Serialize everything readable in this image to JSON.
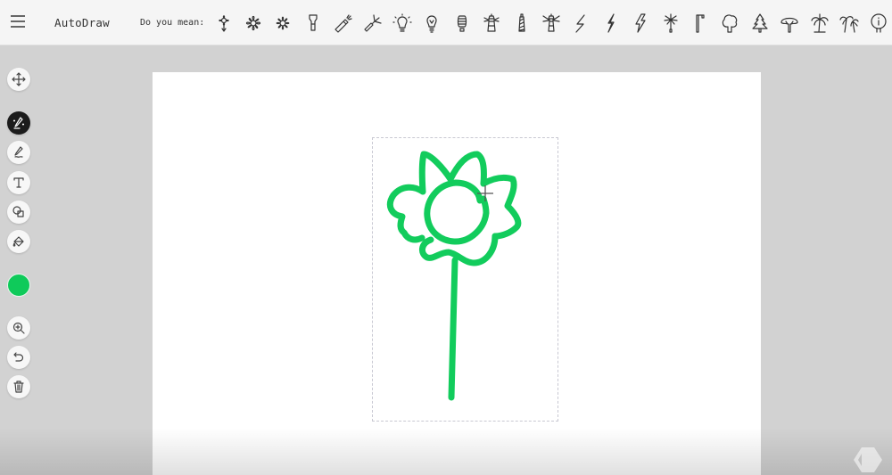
{
  "header": {
    "menu_icon": "hamburger-menu-icon",
    "title": "AutoDraw",
    "suggestions_label": "Do you mean:",
    "suggestions": [
      {
        "name": "flower-simple-icon"
      },
      {
        "name": "flower-detailed-icon"
      },
      {
        "name": "flower-daisy-icon"
      },
      {
        "name": "flashlight-icon"
      },
      {
        "name": "flashlight-beam-icon"
      },
      {
        "name": "flashlight-angled-icon"
      },
      {
        "name": "light-bulb-glowing-icon"
      },
      {
        "name": "light-bulb-icon"
      },
      {
        "name": "cfl-bulb-icon"
      },
      {
        "name": "lighthouse-icon"
      },
      {
        "name": "lighthouse-striped-icon"
      },
      {
        "name": "lighthouse-beam-icon"
      },
      {
        "name": "lightning-bolt-thin-icon"
      },
      {
        "name": "lightning-bolt-icon"
      },
      {
        "name": "lightning-bolt-outline-icon"
      },
      {
        "name": "fireworks-icon"
      },
      {
        "name": "street-lamp-icon"
      },
      {
        "name": "tree-round-icon"
      },
      {
        "name": "pine-tree-icon"
      },
      {
        "name": "tree-wide-icon"
      },
      {
        "name": "palm-tree-icon"
      },
      {
        "name": "palm-trees-icon"
      },
      {
        "name": "info-icon"
      }
    ]
  },
  "toolbar": {
    "tools": [
      {
        "name": "move-tool",
        "icon": "move-arrows-icon",
        "active": false
      },
      {
        "name": "autodraw-tool",
        "icon": "autodraw-sparkle-pencil-icon",
        "active": true
      },
      {
        "name": "draw-tool",
        "icon": "pencil-icon",
        "active": false
      },
      {
        "name": "type-tool",
        "icon": "text-icon",
        "active": false
      },
      {
        "name": "shape-tool",
        "icon": "shapes-icon",
        "active": false
      },
      {
        "name": "fill-tool",
        "icon": "paint-bucket-icon",
        "active": false
      },
      {
        "name": "zoom-tool",
        "icon": "zoom-in-icon",
        "active": false
      },
      {
        "name": "undo-tool",
        "icon": "undo-icon",
        "active": false
      },
      {
        "name": "delete-tool",
        "icon": "trash-icon",
        "active": false
      }
    ],
    "current_color": "#0fca5a"
  },
  "canvas": {
    "stroke_color": "#12cc5c",
    "drawing": "hand-drawn flower with stem"
  }
}
